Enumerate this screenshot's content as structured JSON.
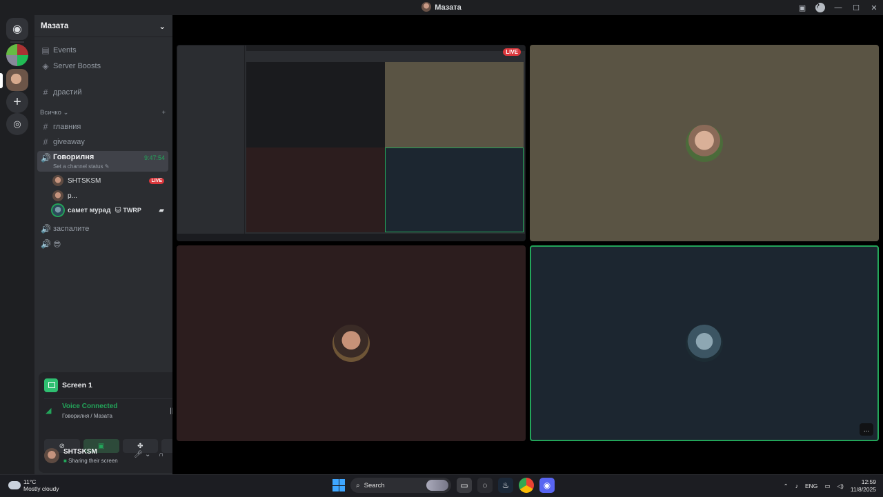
{
  "window": {
    "title": "Мазата"
  },
  "server": {
    "name": "Мазата"
  },
  "sidebar": {
    "events": "Events",
    "boosts": "Server Boosts",
    "top_channel": "драстий",
    "category": "Всичко",
    "channels": [
      {
        "name": "главния",
        "type": "text"
      },
      {
        "name": "giveaway",
        "type": "text"
      }
    ],
    "active_voice": {
      "name": "Говорилня",
      "time": "9:47:54",
      "status": "Set a channel status"
    },
    "voice_users": [
      {
        "name": "SHTSKSM",
        "badge": "LIVE"
      },
      {
        "name": "p..."
      },
      {
        "name": "самет мурад",
        "tag": "🐱 TWRP"
      }
    ],
    "other_voice": [
      {
        "name": "заспалите"
      },
      {
        "name": "😎"
      }
    ]
  },
  "panel": {
    "screen_label": "Screen 1",
    "voice_status": "Voice Connected",
    "voice_location": "Говорилня / Мазата",
    "user_name": "SHTSKSM",
    "user_status": "Sharing their screen"
  },
  "stage": {
    "live_badge": "LIVE",
    "more_label": "..."
  },
  "taskbar": {
    "temp": "11°C",
    "weather": "Mostly cloudy",
    "search": "Search",
    "lang": "ENG",
    "time": "12:59",
    "date": "11/8/2025"
  },
  "colors": {
    "accent_green": "#23a55a",
    "live_red": "#da373c",
    "tile_olive": "#5a5444",
    "tile_maroon": "#2c1d1e",
    "tile_navy": "#1c2630"
  }
}
